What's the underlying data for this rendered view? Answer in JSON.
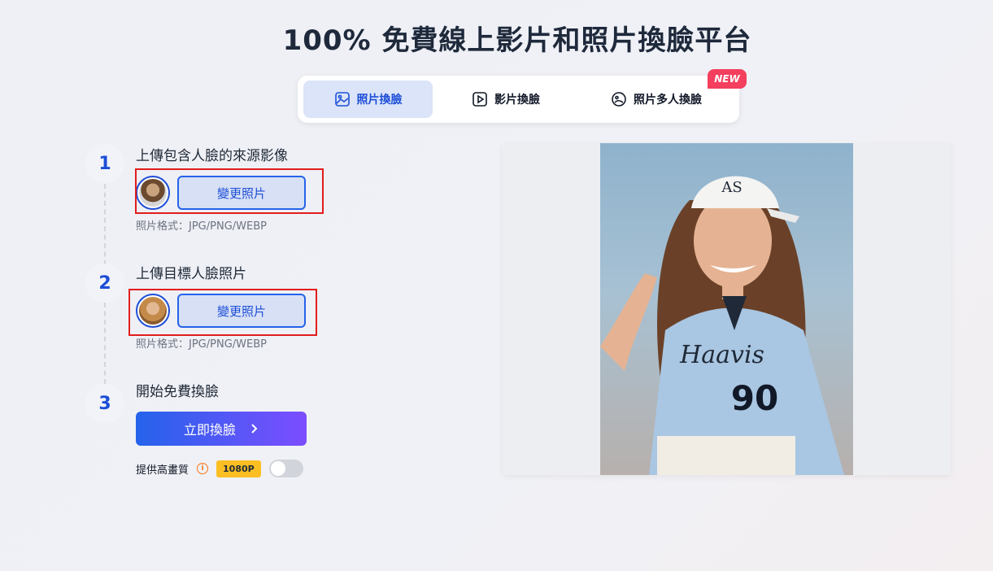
{
  "title": "100% 免費線上影片和照片換臉平台",
  "tabs": [
    {
      "label": "照片換臉",
      "icon": "image-icon",
      "active": true
    },
    {
      "label": "影片換臉",
      "icon": "video-play-icon",
      "active": false
    },
    {
      "label": "照片多人換臉",
      "icon": "multi-face-icon",
      "active": false
    }
  ],
  "new_badge": "NEW",
  "steps": [
    {
      "number": "1",
      "title": "上傳包含人臉的來源影像",
      "button": "變更照片",
      "format": "照片格式：JPG/PNG/WEBP"
    },
    {
      "number": "2",
      "title": "上傳目標人臉照片",
      "button": "變更照片",
      "format": "照片格式：JPG/PNG/WEBP"
    },
    {
      "number": "3",
      "title": "開始免費換臉",
      "button": "立即換臉"
    }
  ],
  "hq": {
    "label": "提供高畫質",
    "badge": "1080P",
    "enabled": false
  },
  "preview": {
    "jersey_text": "Haavis",
    "jersey_number": "90",
    "cap_logo": "AS"
  },
  "colors": {
    "accent": "#1d4ed8",
    "badge_red": "#f43f5e",
    "gold": "#fbbf24"
  }
}
